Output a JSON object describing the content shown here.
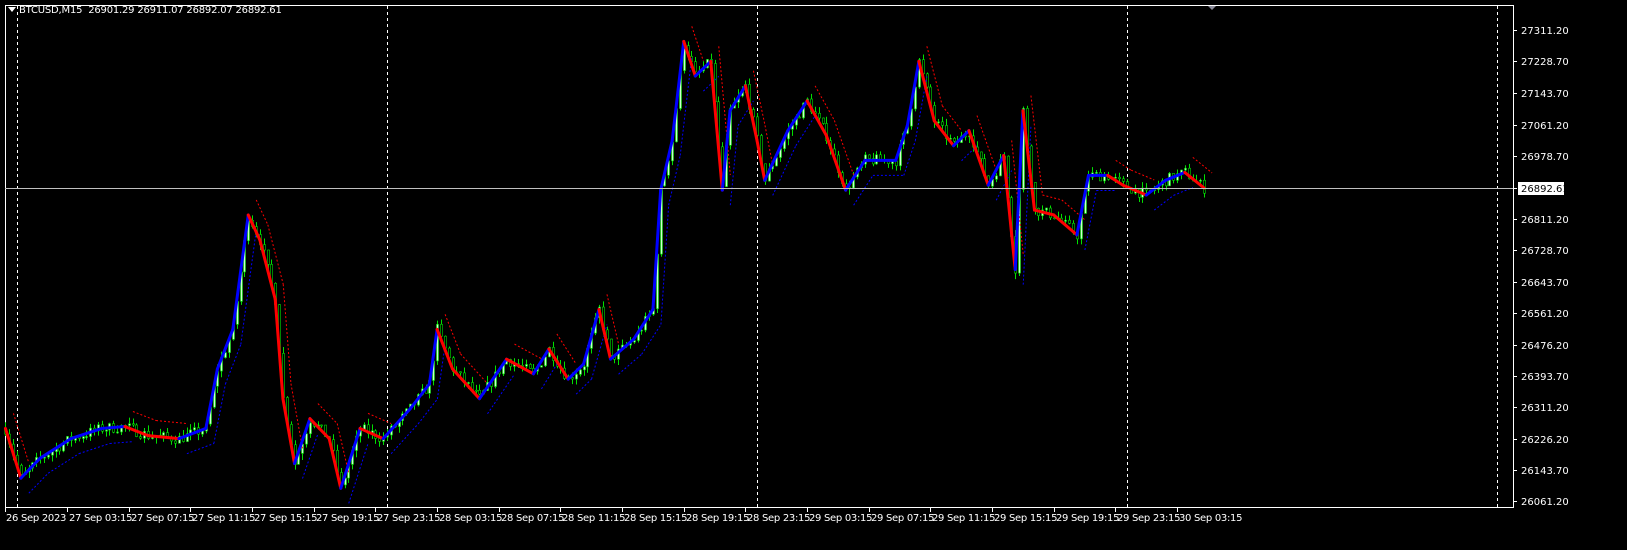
{
  "header": {
    "symbol": "BTCUSD,M15",
    "ohlc": "26901.29 26911.07 26892.07 26892.61"
  },
  "colors": {
    "background": "#000000",
    "grid_separator": "#ffffff",
    "bull_body": "#ccffcc",
    "candle_outline": "#00e000",
    "trend_up": "#0000ff",
    "trend_down": "#ff0000",
    "bid_line": "#c0c0c0"
  },
  "chart_data": {
    "type": "candlestick",
    "timeframe": "M15",
    "symbol": "BTCUSD",
    "current_price": 26892.61,
    "y_ticks": [
      "27311.20",
      "27228.70",
      "27143.70",
      "27061.20",
      "26978.70",
      "26892.61",
      "26811.20",
      "26728.70",
      "26643.70",
      "26561.20",
      "26476.20",
      "26393.70",
      "26311.20",
      "26226.20",
      "26143.70",
      "26061.20"
    ],
    "ylim": [
      26061.2,
      27311.2
    ],
    "x_ticks": [
      "26 Sep 2023",
      "27 Sep 03:15",
      "27 Sep 07:15",
      "27 Sep 11:15",
      "27 Sep 15:15",
      "27 Sep 19:15",
      "27 Sep 23:15",
      "28 Sep 03:15",
      "28 Sep 07:15",
      "28 Sep 11:15",
      "28 Sep 15:15",
      "28 Sep 19:15",
      "28 Sep 23:15",
      "29 Sep 03:15",
      "29 Sep 07:15",
      "29 Sep 11:15",
      "29 Sep 15:15",
      "29 Sep 19:15",
      "29 Sep 23:15",
      "30 Sep 03:15"
    ],
    "day_separators": [
      "27 Sep 00:00",
      "28 Sep 00:00",
      "29 Sep 00:00",
      "30 Sep 00:00",
      "01 Oct 00:00"
    ],
    "approx_closes": [
      [
        "26 Sep 23:15",
        26254
      ],
      [
        "27 Sep 00:15",
        26122
      ],
      [
        "27 Sep 01:30",
        26175
      ],
      [
        "27 Sep 03:30",
        26227
      ],
      [
        "27 Sep 05:30",
        26254
      ],
      [
        "27 Sep 07:00",
        26259
      ],
      [
        "27 Sep 08:30",
        26235
      ],
      [
        "27 Sep 10:30",
        26227
      ],
      [
        "27 Sep 12:15",
        26254
      ],
      [
        "27 Sep 13:00",
        26412
      ],
      [
        "27 Sep 14:00",
        26517
      ],
      [
        "27 Sep 15:00",
        26821
      ],
      [
        "27 Sep 15:45",
        26755
      ],
      [
        "27 Sep 16:45",
        26597
      ],
      [
        "27 Sep 17:15",
        26333
      ],
      [
        "27 Sep 18:00",
        26161
      ],
      [
        "27 Sep 19:00",
        26280
      ],
      [
        "27 Sep 20:15",
        26227
      ],
      [
        "27 Sep 21:00",
        26095
      ],
      [
        "27 Sep 22:15",
        26254
      ],
      [
        "27 Sep 23:45",
        26227
      ],
      [
        "28 Sep 01:30",
        26306
      ],
      [
        "28 Sep 02:45",
        26372
      ],
      [
        "28 Sep 03:15",
        26517
      ],
      [
        "28 Sep 04:15",
        26412
      ],
      [
        "28 Sep 06:00",
        26333
      ],
      [
        "28 Sep 07:45",
        26438
      ],
      [
        "28 Sep 09:30",
        26399
      ],
      [
        "28 Sep 10:30",
        26465
      ],
      [
        "28 Sep 11:45",
        26385
      ],
      [
        "28 Sep 12:45",
        26425
      ],
      [
        "28 Sep 13:45",
        26570
      ],
      [
        "28 Sep 14:30",
        26438
      ],
      [
        "28 Sep 16:00",
        26491
      ],
      [
        "28 Sep 17:15",
        26570
      ],
      [
        "28 Sep 17:45",
        26887
      ],
      [
        "28 Sep 18:30",
        27019
      ],
      [
        "28 Sep 19:15",
        27282
      ],
      [
        "28 Sep 20:00",
        27190
      ],
      [
        "28 Sep 21:00",
        27229
      ],
      [
        "28 Sep 21:45",
        26887
      ],
      [
        "28 Sep 22:15",
        27098
      ],
      [
        "28 Sep 23:15",
        27164
      ],
      [
        "29 Sep 00:00",
        27019
      ],
      [
        "29 Sep 00:30",
        26913
      ],
      [
        "29 Sep 02:00",
        27045
      ],
      [
        "29 Sep 03:15",
        27124
      ],
      [
        "29 Sep 04:30",
        27032
      ],
      [
        "29 Sep 05:45",
        26887
      ],
      [
        "29 Sep 07:00",
        26966
      ],
      [
        "29 Sep 09:00",
        26966
      ],
      [
        "29 Sep 09:45",
        27058
      ],
      [
        "29 Sep 10:30",
        27229
      ],
      [
        "29 Sep 11:30",
        27071
      ],
      [
        "29 Sep 12:45",
        27005
      ],
      [
        "29 Sep 13:45",
        27045
      ],
      [
        "29 Sep 15:00",
        26900
      ],
      [
        "29 Sep 16:00",
        26979
      ],
      [
        "29 Sep 16:45",
        26676
      ],
      [
        "29 Sep 17:15",
        27098
      ],
      [
        "29 Sep 18:00",
        26834
      ],
      [
        "29 Sep 19:15",
        26821
      ],
      [
        "29 Sep 20:45",
        26768
      ],
      [
        "29 Sep 21:30",
        26926
      ],
      [
        "29 Sep 22:45",
        26926
      ],
      [
        "29 Sep 23:45",
        26900
      ],
      [
        "30 Sep 01:15",
        26874
      ],
      [
        "30 Sep 02:30",
        26913
      ],
      [
        "30 Sep 03:45",
        26934
      ],
      [
        "30 Sep 05:00",
        26892.61
      ]
    ]
  }
}
